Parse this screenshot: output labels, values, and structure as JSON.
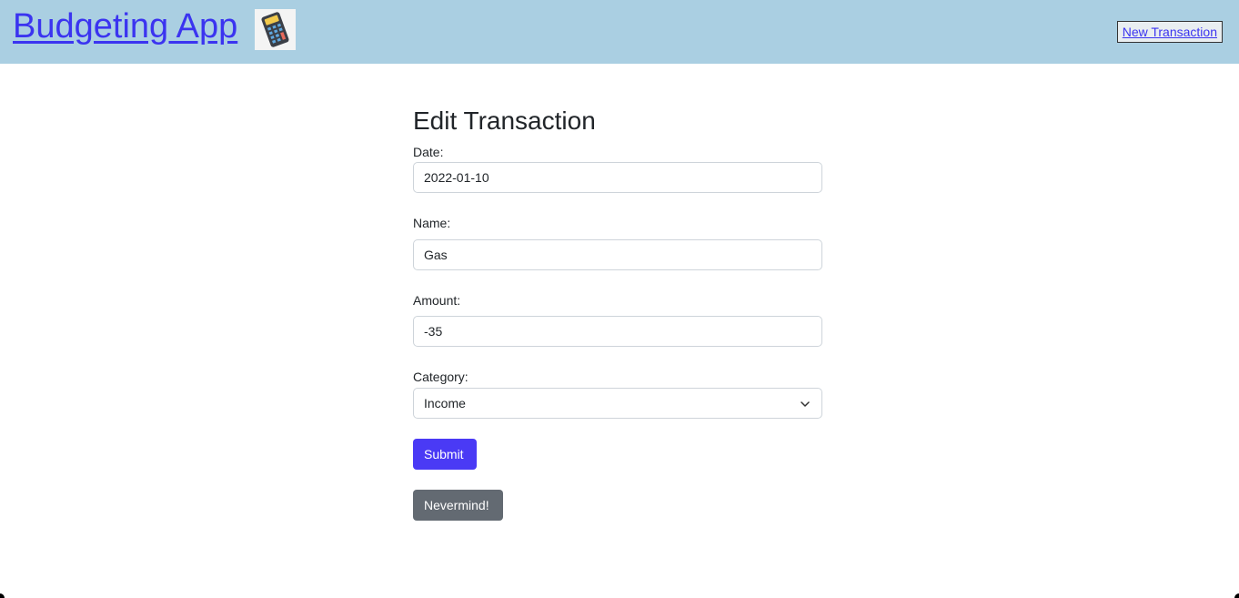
{
  "header": {
    "brand_title": "Budgeting App",
    "brand_icon": "calculator-icon",
    "new_transaction_label": "New Transaction",
    "background_color": "#aacfe2",
    "link_color": "#3b34f0"
  },
  "form": {
    "title": "Edit Transaction",
    "date": {
      "label": "Date:",
      "value": "2022-01-10"
    },
    "name": {
      "label": "Name:",
      "value": "Gas"
    },
    "amount": {
      "label": "Amount:",
      "value": "-35"
    },
    "category": {
      "label": "Category:",
      "selected": "Income"
    },
    "submit_label": "Submit",
    "cancel_label": "Nevermind!",
    "submit_color": "#4a3af5",
    "cancel_color": "#636a72"
  }
}
